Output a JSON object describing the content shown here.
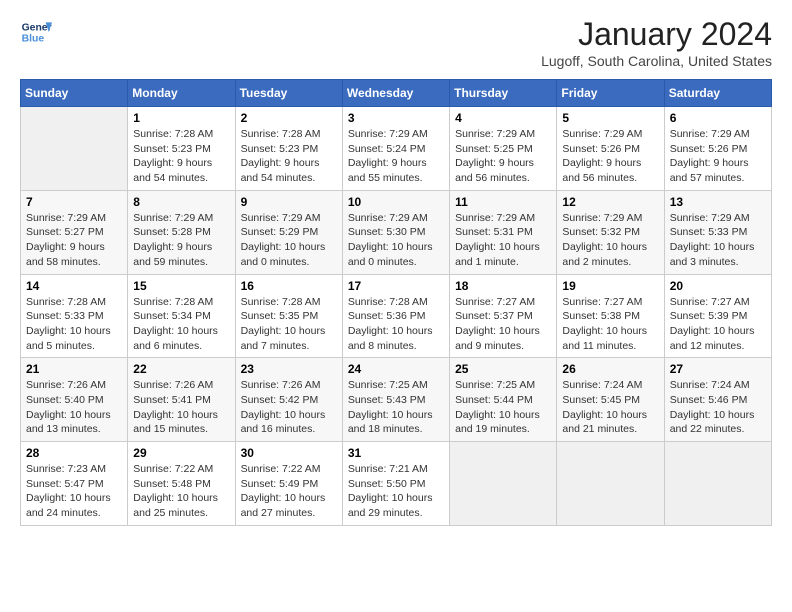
{
  "logo": {
    "line1": "General",
    "line2": "Blue"
  },
  "title": "January 2024",
  "subtitle": "Lugoff, South Carolina, United States",
  "days_of_week": [
    "Sunday",
    "Monday",
    "Tuesday",
    "Wednesday",
    "Thursday",
    "Friday",
    "Saturday"
  ],
  "weeks": [
    [
      {
        "day": "",
        "info": ""
      },
      {
        "day": "1",
        "info": "Sunrise: 7:28 AM\nSunset: 5:23 PM\nDaylight: 9 hours\nand 54 minutes."
      },
      {
        "day": "2",
        "info": "Sunrise: 7:28 AM\nSunset: 5:23 PM\nDaylight: 9 hours\nand 54 minutes."
      },
      {
        "day": "3",
        "info": "Sunrise: 7:29 AM\nSunset: 5:24 PM\nDaylight: 9 hours\nand 55 minutes."
      },
      {
        "day": "4",
        "info": "Sunrise: 7:29 AM\nSunset: 5:25 PM\nDaylight: 9 hours\nand 56 minutes."
      },
      {
        "day": "5",
        "info": "Sunrise: 7:29 AM\nSunset: 5:26 PM\nDaylight: 9 hours\nand 56 minutes."
      },
      {
        "day": "6",
        "info": "Sunrise: 7:29 AM\nSunset: 5:26 PM\nDaylight: 9 hours\nand 57 minutes."
      }
    ],
    [
      {
        "day": "7",
        "info": "Sunrise: 7:29 AM\nSunset: 5:27 PM\nDaylight: 9 hours\nand 58 minutes."
      },
      {
        "day": "8",
        "info": "Sunrise: 7:29 AM\nSunset: 5:28 PM\nDaylight: 9 hours\nand 59 minutes."
      },
      {
        "day": "9",
        "info": "Sunrise: 7:29 AM\nSunset: 5:29 PM\nDaylight: 10 hours\nand 0 minutes."
      },
      {
        "day": "10",
        "info": "Sunrise: 7:29 AM\nSunset: 5:30 PM\nDaylight: 10 hours\nand 0 minutes."
      },
      {
        "day": "11",
        "info": "Sunrise: 7:29 AM\nSunset: 5:31 PM\nDaylight: 10 hours\nand 1 minute."
      },
      {
        "day": "12",
        "info": "Sunrise: 7:29 AM\nSunset: 5:32 PM\nDaylight: 10 hours\nand 2 minutes."
      },
      {
        "day": "13",
        "info": "Sunrise: 7:29 AM\nSunset: 5:33 PM\nDaylight: 10 hours\nand 3 minutes."
      }
    ],
    [
      {
        "day": "14",
        "info": "Sunrise: 7:28 AM\nSunset: 5:33 PM\nDaylight: 10 hours\nand 5 minutes."
      },
      {
        "day": "15",
        "info": "Sunrise: 7:28 AM\nSunset: 5:34 PM\nDaylight: 10 hours\nand 6 minutes."
      },
      {
        "day": "16",
        "info": "Sunrise: 7:28 AM\nSunset: 5:35 PM\nDaylight: 10 hours\nand 7 minutes."
      },
      {
        "day": "17",
        "info": "Sunrise: 7:28 AM\nSunset: 5:36 PM\nDaylight: 10 hours\nand 8 minutes."
      },
      {
        "day": "18",
        "info": "Sunrise: 7:27 AM\nSunset: 5:37 PM\nDaylight: 10 hours\nand 9 minutes."
      },
      {
        "day": "19",
        "info": "Sunrise: 7:27 AM\nSunset: 5:38 PM\nDaylight: 10 hours\nand 11 minutes."
      },
      {
        "day": "20",
        "info": "Sunrise: 7:27 AM\nSunset: 5:39 PM\nDaylight: 10 hours\nand 12 minutes."
      }
    ],
    [
      {
        "day": "21",
        "info": "Sunrise: 7:26 AM\nSunset: 5:40 PM\nDaylight: 10 hours\nand 13 minutes."
      },
      {
        "day": "22",
        "info": "Sunrise: 7:26 AM\nSunset: 5:41 PM\nDaylight: 10 hours\nand 15 minutes."
      },
      {
        "day": "23",
        "info": "Sunrise: 7:26 AM\nSunset: 5:42 PM\nDaylight: 10 hours\nand 16 minutes."
      },
      {
        "day": "24",
        "info": "Sunrise: 7:25 AM\nSunset: 5:43 PM\nDaylight: 10 hours\nand 18 minutes."
      },
      {
        "day": "25",
        "info": "Sunrise: 7:25 AM\nSunset: 5:44 PM\nDaylight: 10 hours\nand 19 minutes."
      },
      {
        "day": "26",
        "info": "Sunrise: 7:24 AM\nSunset: 5:45 PM\nDaylight: 10 hours\nand 21 minutes."
      },
      {
        "day": "27",
        "info": "Sunrise: 7:24 AM\nSunset: 5:46 PM\nDaylight: 10 hours\nand 22 minutes."
      }
    ],
    [
      {
        "day": "28",
        "info": "Sunrise: 7:23 AM\nSunset: 5:47 PM\nDaylight: 10 hours\nand 24 minutes."
      },
      {
        "day": "29",
        "info": "Sunrise: 7:22 AM\nSunset: 5:48 PM\nDaylight: 10 hours\nand 25 minutes."
      },
      {
        "day": "30",
        "info": "Sunrise: 7:22 AM\nSunset: 5:49 PM\nDaylight: 10 hours\nand 27 minutes."
      },
      {
        "day": "31",
        "info": "Sunrise: 7:21 AM\nSunset: 5:50 PM\nDaylight: 10 hours\nand 29 minutes."
      },
      {
        "day": "",
        "info": ""
      },
      {
        "day": "",
        "info": ""
      },
      {
        "day": "",
        "info": ""
      }
    ]
  ]
}
